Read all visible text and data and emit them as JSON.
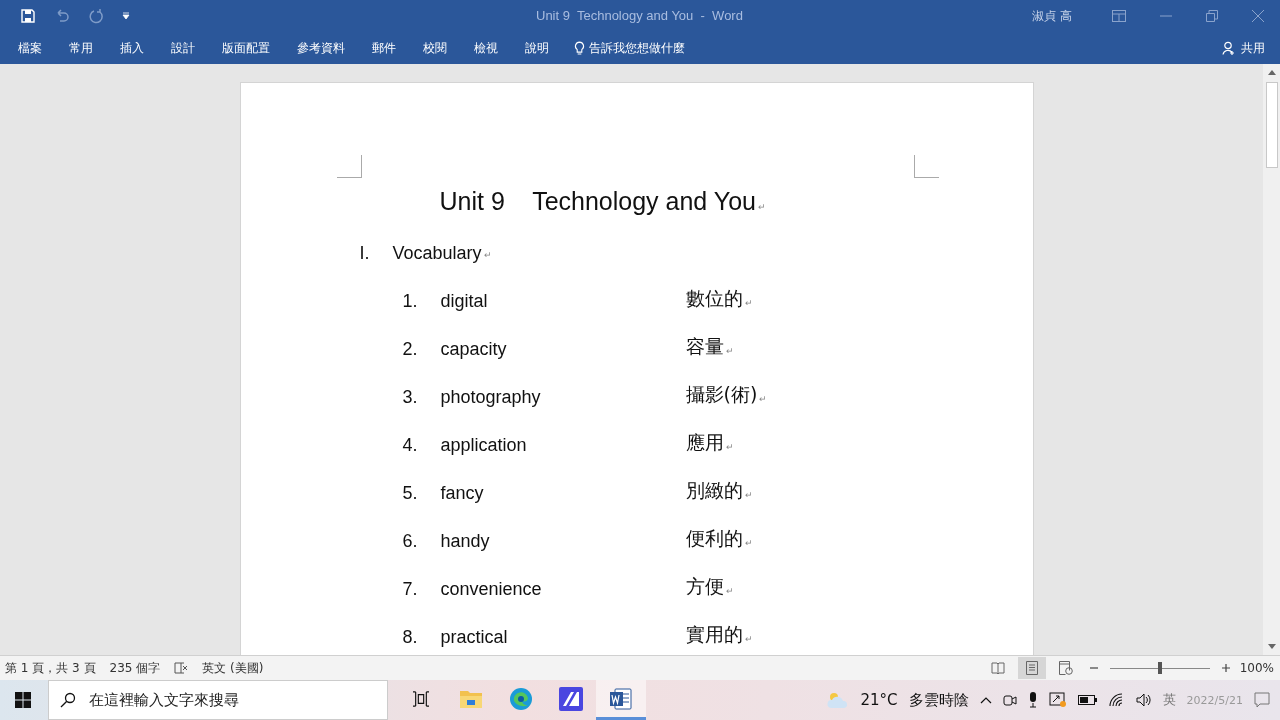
{
  "window": {
    "title": "Unit 9  Technology and You  -  Word",
    "user": "淑貞 高"
  },
  "ribbon": {
    "tabs": [
      {
        "label": "檔案",
        "selected": false
      },
      {
        "label": "常用",
        "selected": false
      },
      {
        "label": "插入",
        "selected": false
      },
      {
        "label": "設計",
        "selected": false
      },
      {
        "label": "版面配置",
        "selected": false
      },
      {
        "label": "參考資料",
        "selected": false
      },
      {
        "label": "郵件",
        "selected": false
      },
      {
        "label": "校閱",
        "selected": false
      },
      {
        "label": "檢視",
        "selected": false
      },
      {
        "label": "說明",
        "selected": false
      }
    ],
    "tell_me": "告訴我您想做什麼",
    "share": "共用"
  },
  "document": {
    "title": "Unit 9    Technology and You",
    "title_mark": "↵",
    "section": {
      "number": "I.",
      "label": "Vocabulary",
      "mark": "↵"
    },
    "items": [
      {
        "number": "1.",
        "word": "digital",
        "meaning": "數位的",
        "mark": "↵"
      },
      {
        "number": "2.",
        "word": "capacity",
        "meaning": "容量",
        "mark": "↵"
      },
      {
        "number": "3.",
        "word": "photography",
        "meaning": "攝影(術)",
        "mark": "↵"
      },
      {
        "number": "4.",
        "word": "application",
        "meaning": "應用",
        "mark": "↵"
      },
      {
        "number": "5.",
        "word": "fancy",
        "meaning": "別緻的",
        "mark": "↵"
      },
      {
        "number": "6.",
        "word": "handy",
        "meaning": "便利的",
        "mark": "↵"
      },
      {
        "number": "7.",
        "word": "convenience",
        "meaning": "方便",
        "mark": "↵"
      },
      {
        "number": "8.",
        "word": "practical",
        "meaning": "實用的",
        "mark": "↵"
      }
    ]
  },
  "status_bar": {
    "page": "第 1 頁，共 3 頁",
    "words": "235 個字",
    "language": "英文 (美國)",
    "views": [
      {
        "kind": "read",
        "selected": false
      },
      {
        "kind": "print",
        "selected": true
      },
      {
        "kind": "web",
        "selected": false
      }
    ],
    "zoom": {
      "level": 0.5,
      "reading": "100%"
    }
  },
  "taskbar": {
    "search": {
      "placeholder": "在這裡輸入文字來搜尋"
    },
    "apps": [
      {
        "kind": "taskview",
        "selected": false
      },
      {
        "kind": "explorer",
        "selected": false
      },
      {
        "kind": "edge",
        "selected": false
      },
      {
        "kind": "app",
        "selected": false
      },
      {
        "kind": "word",
        "selected": true
      }
    ],
    "weather": {
      "temperature": "21°C",
      "condition": "多雲時陰"
    },
    "ime": "英",
    "date": "2022/5/21"
  }
}
